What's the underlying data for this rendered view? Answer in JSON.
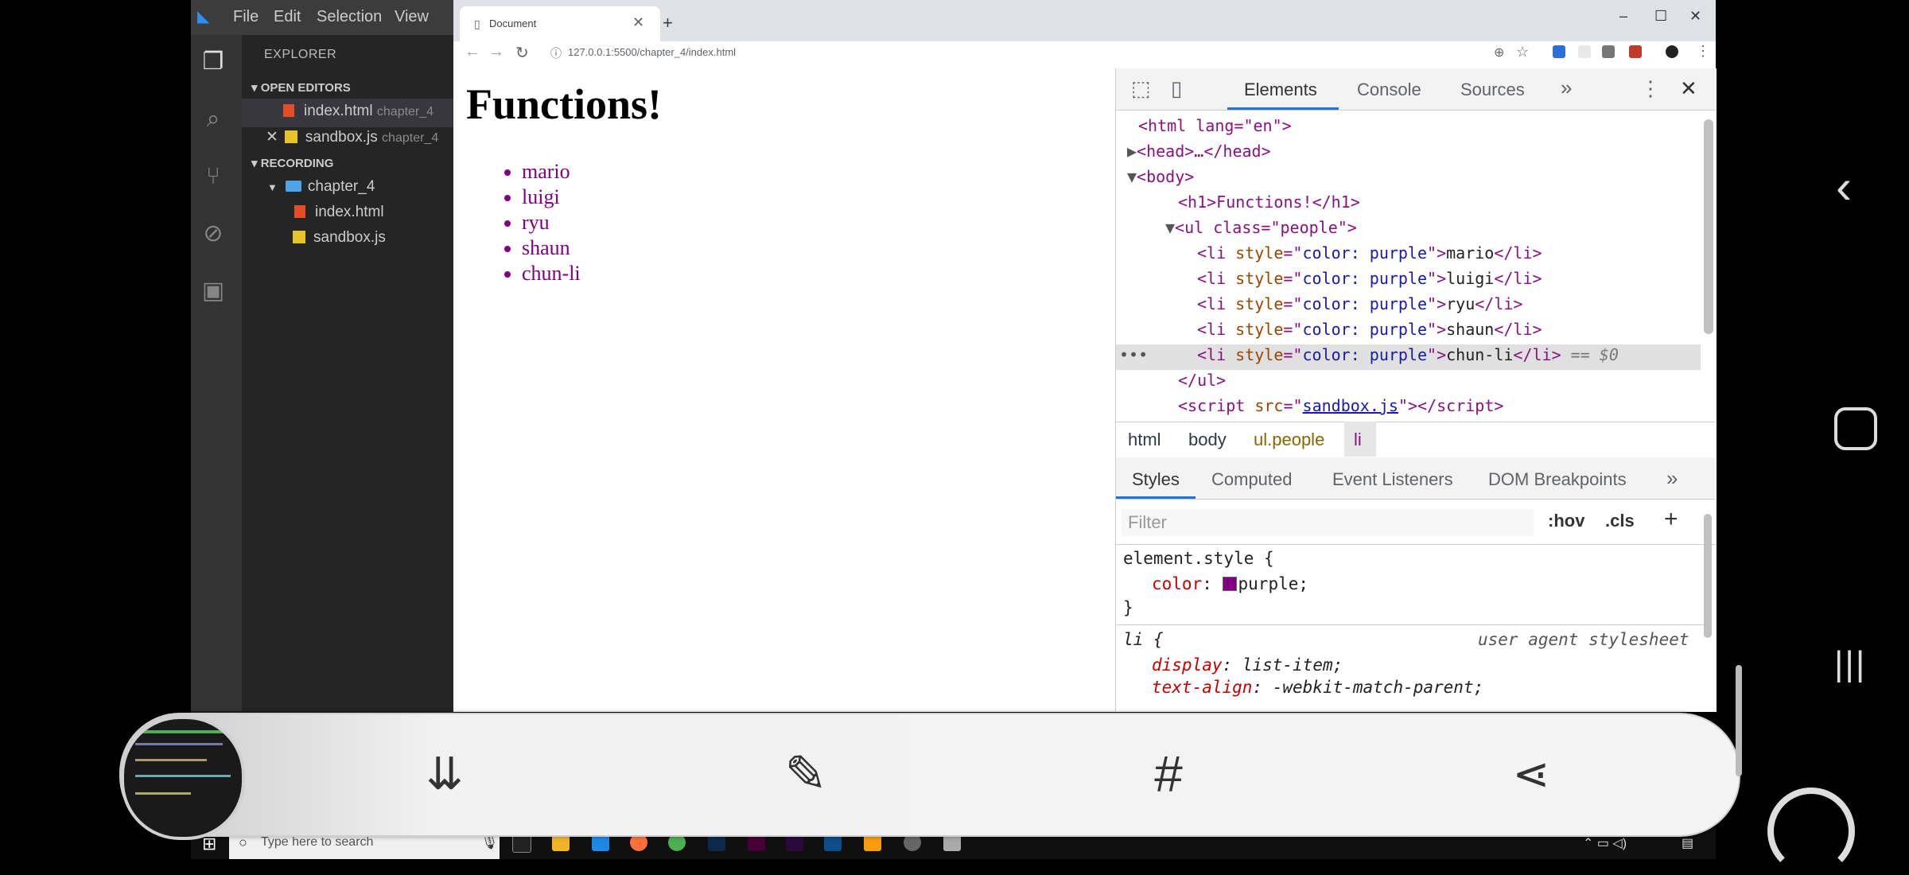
{
  "vscode": {
    "menu": [
      "File",
      "Edit",
      "Selection",
      "View"
    ],
    "explorer_title": "EXPLORER",
    "open_editors_label": "OPEN EDITORS",
    "open_editors": [
      {
        "name": "index.html",
        "folder": "chapter_4"
      },
      {
        "name": "sandbox.js",
        "folder": "chapter_4"
      }
    ],
    "project_label": "RECORDING",
    "folder": "chapter_4",
    "files": [
      "index.html",
      "sandbox.js"
    ]
  },
  "chrome": {
    "tab_title": "Document",
    "url": "127.0.0.1:5500/chapter_4/index.html"
  },
  "page": {
    "heading": "Functions!",
    "items": [
      "mario",
      "luigi",
      "ryu",
      "shaun",
      "chun-li"
    ],
    "item_color": "#800080"
  },
  "devtools": {
    "tabs": [
      "Elements",
      "Console",
      "Sources"
    ],
    "more": "»",
    "dom": {
      "html_open": "<html lang=\"en\">",
      "head": "<head>…</head>",
      "body_open": "<body>",
      "h1": "<h1>Functions!</h1>",
      "ul_open": "<ul class=\"people\">",
      "li_style": "color: purple",
      "li_values": [
        "mario",
        "luigi",
        "ryu",
        "shaun",
        "chun-li"
      ],
      "selected_suffix": "== $0",
      "ul_close": "</ul>",
      "script_src": "sandbox.js"
    },
    "breadcrumb": [
      "html",
      "body",
      "ul.people",
      "li"
    ],
    "sub_tabs": [
      "Styles",
      "Computed",
      "Event Listeners",
      "DOM Breakpoints"
    ],
    "filter_placeholder": "Filter",
    "hov": ":hov",
    "cls": ".cls",
    "styles": {
      "element_style": "element.style {",
      "color_prop": "color",
      "color_val": "purple;",
      "close": "}",
      "li_rule": "li {",
      "ua_label": "user agent stylesheet",
      "display_prop": "display",
      "display_val": "list-item;",
      "align_prop": "text-align",
      "align_val": "-webkit-match-parent;"
    }
  },
  "taskbar": {
    "search_placeholder": "Type here to search"
  }
}
